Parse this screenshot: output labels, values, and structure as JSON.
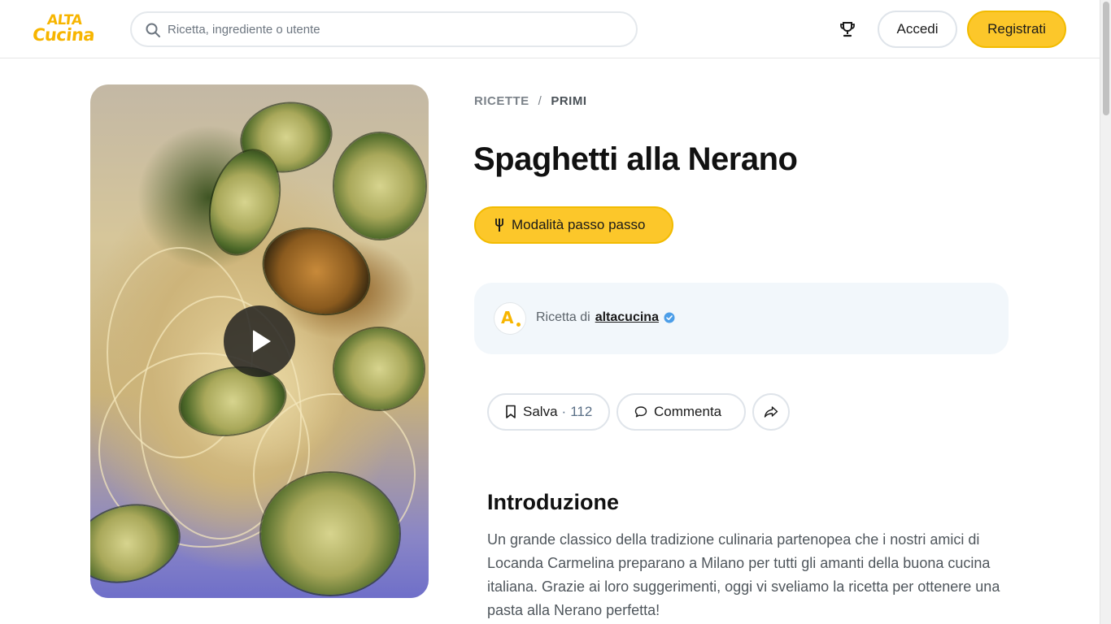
{
  "header": {
    "logo_line1": "ALTA",
    "logo_line2": "Cucina",
    "search_placeholder": "Ricetta, ingrediente o utente",
    "login_label": "Accedi",
    "register_label": "Registrati",
    "icons": {
      "search": "search-icon",
      "trophy": "trophy-icon"
    }
  },
  "media": {
    "type": "video",
    "play_icon": "play-icon"
  },
  "breadcrumb": {
    "root": "RICETTE",
    "separator": "/",
    "current": "PRIMI"
  },
  "recipe": {
    "title": "Spaghetti alla Nerano",
    "step_mode_label": "Modalità passo passo"
  },
  "author": {
    "prefix": "Ricetta di",
    "name": "altacucina",
    "avatar_letter": "A",
    "verified": true
  },
  "actions": {
    "save_label": "Salva",
    "save_separator": "·",
    "save_count": "112",
    "comment_label": "Commenta",
    "share_icon": "share-icon"
  },
  "intro": {
    "heading": "Introduzione",
    "text": "Un grande classico della tradizione culinaria partenopea che i nostri amici di Locanda Carmelina preparano a Milano per tutti gli amanti della buona cucina italiana. Grazie ai loro suggerimenti, oggi vi sveliamo la ricetta per ottenere una pasta alla Nerano perfetta!"
  },
  "colors": {
    "accent": "#fcc72a",
    "logo": "#f7b500",
    "card_bg": "#f2f7fb",
    "verified": "#4c9ee8"
  }
}
